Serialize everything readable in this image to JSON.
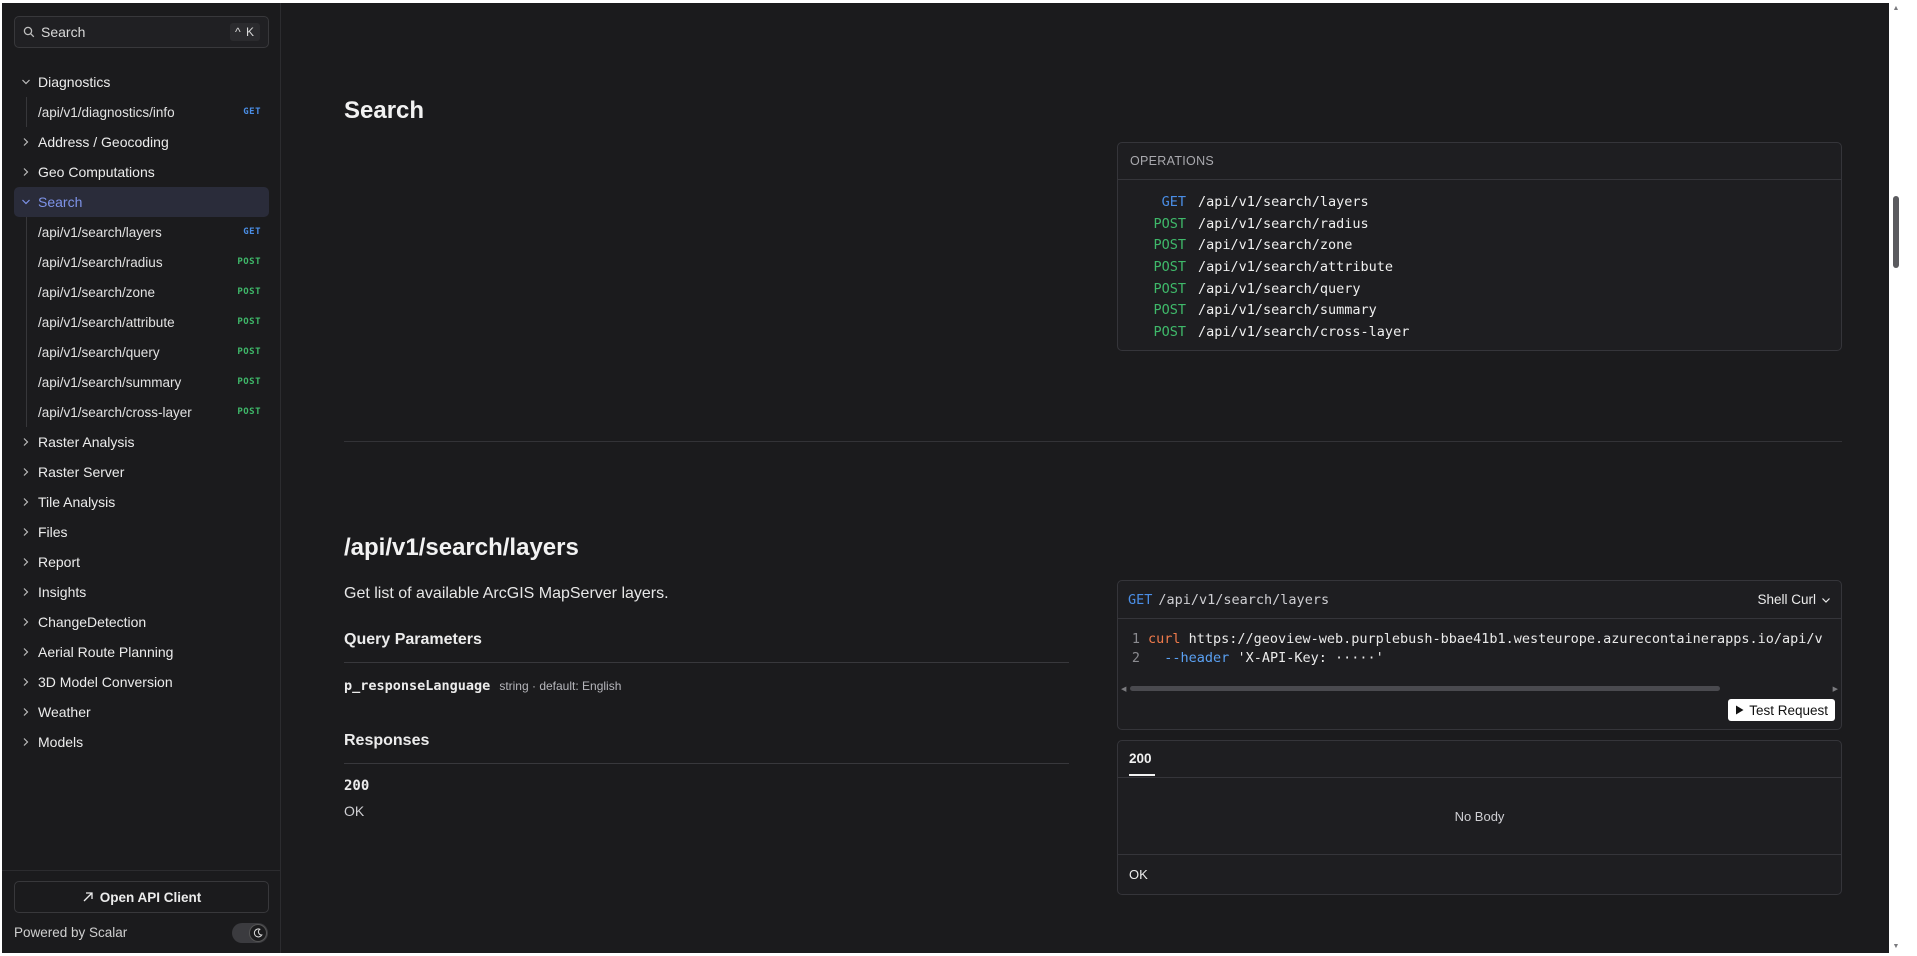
{
  "sidebar": {
    "search": {
      "placeholder": "Search",
      "shortcut": "^ K"
    },
    "sections": [
      {
        "label": "Diagnostics",
        "expanded": true,
        "items": [
          {
            "path": "/api/v1/diagnostics/info",
            "method": "GET"
          }
        ]
      },
      {
        "label": "Address / Geocoding",
        "expanded": false
      },
      {
        "label": "Geo Computations",
        "expanded": false
      },
      {
        "label": "Search",
        "expanded": true,
        "active": true,
        "items": [
          {
            "path": "/api/v1/search/layers",
            "method": "GET"
          },
          {
            "path": "/api/v1/search/radius",
            "method": "POST"
          },
          {
            "path": "/api/v1/search/zone",
            "method": "POST"
          },
          {
            "path": "/api/v1/search/attribute",
            "method": "POST"
          },
          {
            "path": "/api/v1/search/query",
            "method": "POST"
          },
          {
            "path": "/api/v1/search/summary",
            "method": "POST"
          },
          {
            "path": "/api/v1/search/cross-layer",
            "method": "POST"
          }
        ]
      },
      {
        "label": "Raster Analysis",
        "expanded": false
      },
      {
        "label": "Raster Server",
        "expanded": false
      },
      {
        "label": "Tile Analysis",
        "expanded": false
      },
      {
        "label": "Files",
        "expanded": false
      },
      {
        "label": "Report",
        "expanded": false
      },
      {
        "label": "Insights",
        "expanded": false
      },
      {
        "label": "ChangeDetection",
        "expanded": false
      },
      {
        "label": "Aerial Route Planning",
        "expanded": false
      },
      {
        "label": "3D Model Conversion",
        "expanded": false
      },
      {
        "label": "Weather",
        "expanded": false
      },
      {
        "label": "Models",
        "expanded": false
      }
    ],
    "footer": {
      "open_client_label": "Open API Client",
      "powered_by": "Powered by Scalar"
    }
  },
  "main": {
    "section_title": "Search",
    "operations": {
      "header": "OPERATIONS",
      "rows": [
        {
          "method": "GET",
          "path": "/api/v1/search/layers"
        },
        {
          "method": "POST",
          "path": "/api/v1/search/radius"
        },
        {
          "method": "POST",
          "path": "/api/v1/search/zone"
        },
        {
          "method": "POST",
          "path": "/api/v1/search/attribute"
        },
        {
          "method": "POST",
          "path": "/api/v1/search/query"
        },
        {
          "method": "POST",
          "path": "/api/v1/search/summary"
        },
        {
          "method": "POST",
          "path": "/api/v1/search/cross-layer"
        }
      ]
    },
    "endpoint": {
      "title": "/api/v1/search/layers",
      "description": "Get list of available ArcGIS MapServer layers.",
      "query_params_title": "Query Parameters",
      "param": {
        "name": "p_responseLanguage",
        "meta": "string · default: English"
      },
      "responses_title": "Responses",
      "response_code": "200",
      "response_desc": "OK"
    },
    "request": {
      "method": "GET",
      "path": "/api/v1/search/layers",
      "language": "Shell Curl",
      "line1_num": "1",
      "line1_cmd": "curl",
      "line1_url": "https://geoview-web.purplebush-bbae41b1.westeurope.azurecontainerapps.io/api/v",
      "line2_num": "2",
      "line2_flag": "--header",
      "line2_value": "'X-API-Key: ·····'",
      "test_button": "Test Request"
    },
    "response_panel": {
      "tab": "200",
      "body": "No Body",
      "footer": "OK"
    }
  },
  "colors": {
    "get": "#4a8ee6",
    "post": "#3fb96a",
    "accent": "#7e93e8",
    "background": "#1b1b1d"
  }
}
